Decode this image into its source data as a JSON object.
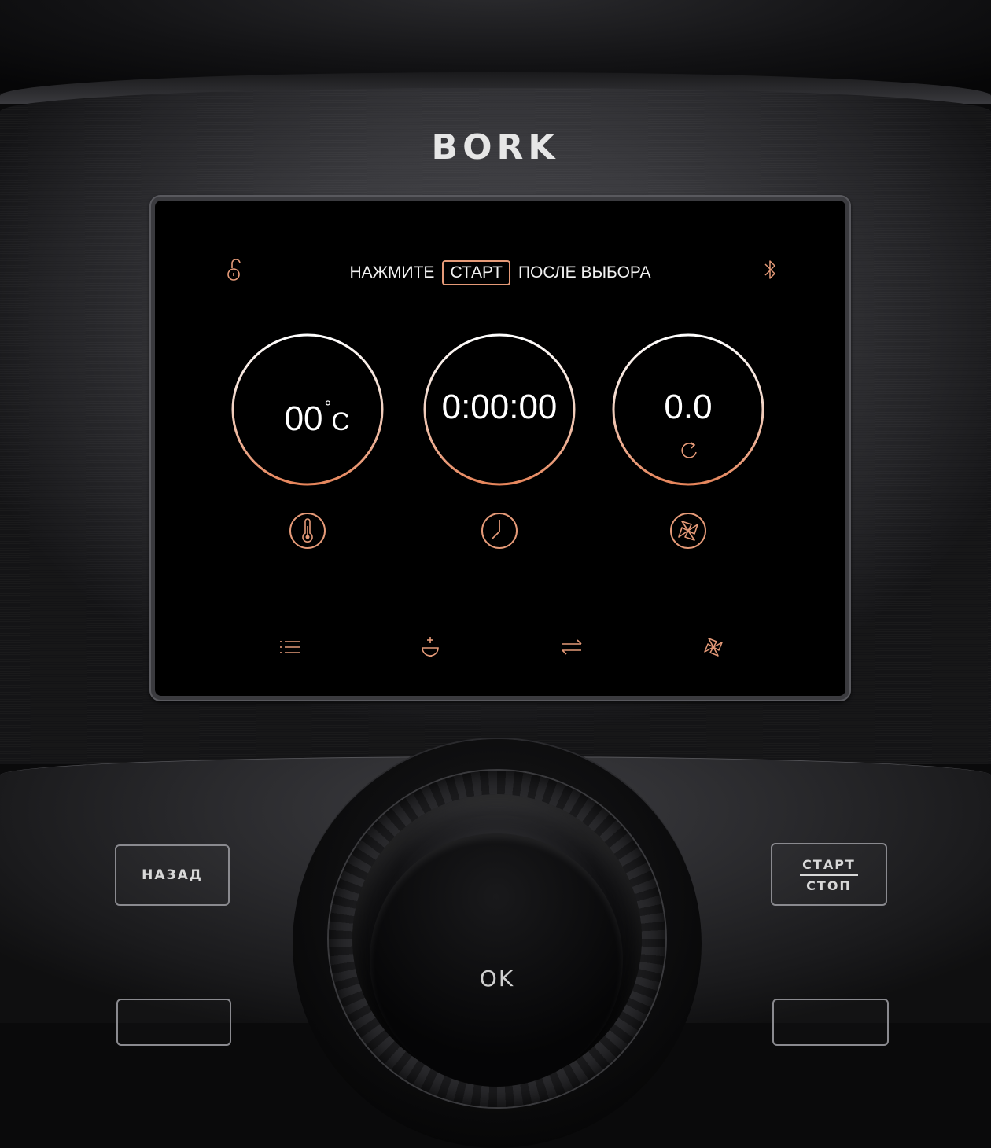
{
  "brand": {
    "logo_text": "BORK"
  },
  "screen": {
    "hint": {
      "before": "НАЖМИТЕ",
      "key": "СТАРТ",
      "after": "ПОСЛЕ ВЫБОРА"
    },
    "status_icons": [
      "lock-open-icon",
      "bluetooth-icon"
    ],
    "gauges": {
      "temperature": {
        "value": "00",
        "unit": "C",
        "degree": "°",
        "icon": "thermometer-icon"
      },
      "timer": {
        "value": "0:00:00",
        "icon": "clock-icon"
      },
      "speed": {
        "value": "0.0",
        "icon": "fan-icon",
        "sub_icon": "rotate-icon"
      }
    },
    "nav_icons": [
      "menu-list-icon",
      "add-ingredient-icon",
      "swap-arrows-icon",
      "fan-icon"
    ]
  },
  "controls": {
    "back_label": "НАЗАД",
    "start_label": "СТАРТ",
    "stop_label": "СТОП",
    "ok_label": "OK"
  },
  "colors": {
    "accent": "#e59a78",
    "ring_top": "#ffffff",
    "ring_bottom": "#e6855b",
    "screen_bg": "#000000"
  }
}
